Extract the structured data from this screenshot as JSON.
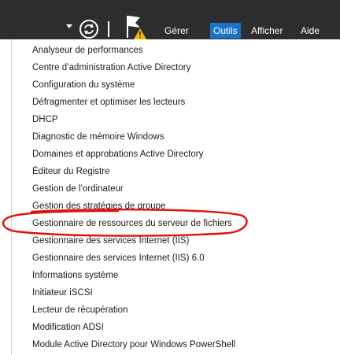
{
  "toolbar": {
    "icons": [
      "chevron-down-icon",
      "refresh-icon",
      "separator",
      "flag-warning-icon"
    ],
    "menus": [
      "Gérer",
      "Outils",
      "Afficher",
      "Aide"
    ],
    "active_menu": "Outils",
    "colors": {
      "bar": "#2d2d30",
      "active": "#1a73c5",
      "warning": "#f5b800",
      "text": "#ffffff"
    }
  },
  "tools_menu": {
    "items": [
      "Analyseur de performances",
      "Centre d’administration Active Directory",
      "Configuration du système",
      "Défragmenter et optimiser les lecteurs",
      "DHCP",
      "Diagnostic de mémoire Windows",
      "Domaines et approbations Active Directory",
      "Éditeur du Registre",
      "Gestion de l’ordinateur",
      "Gestion des stratégies de groupe",
      "Gestionnaire de ressources du serveur de fichiers",
      "Gestionnaire des services Internet (IIS)",
      "Gestionnaire des services Internet (IIS) 6.0",
      "Informations système",
      "Initiateur iSCSI",
      "Lecteur de récupération",
      "Modification ADSI",
      "Module Active Directory pour Windows PowerShell"
    ],
    "circled_item": "Gestionnaire de ressources du serveur de fichiers",
    "annotation_color": "#e01010"
  }
}
